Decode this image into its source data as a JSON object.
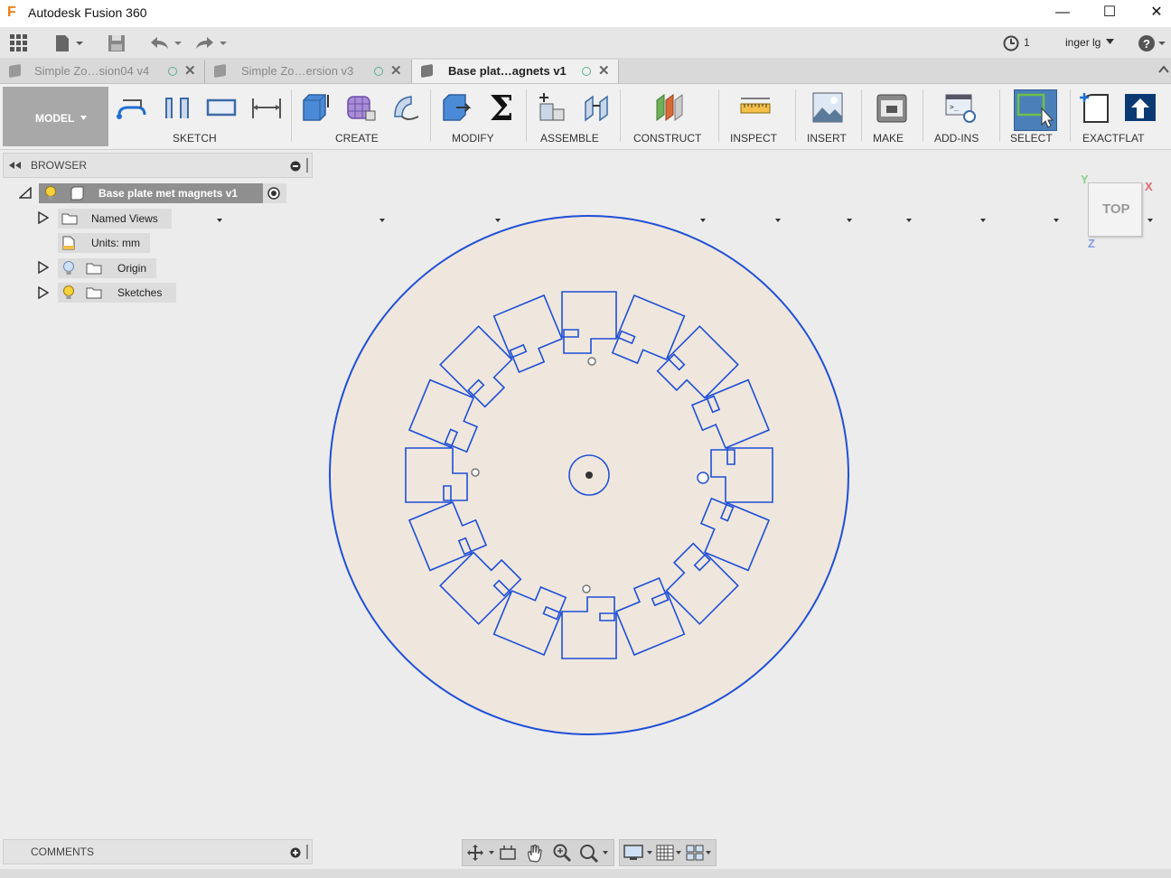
{
  "window": {
    "title": "Autodesk Fusion 360",
    "minimize": "—",
    "maximize": "☐",
    "close": "✕"
  },
  "quick_access": {
    "user": "inger lg",
    "job_count": "1"
  },
  "tabs": [
    {
      "label": "Simple Zo…sion04 v4",
      "active": false
    },
    {
      "label": "Simple Zo…ersion v3",
      "active": false
    },
    {
      "label": "Base plat…agnets v1",
      "active": true
    }
  ],
  "ribbon": {
    "workspace": "MODEL",
    "groups": [
      "SKETCH",
      "CREATE",
      "MODIFY",
      "ASSEMBLE",
      "CONSTRUCT",
      "INSPECT",
      "INSERT",
      "MAKE",
      "ADD-INS",
      "SELECT",
      "EXACTFLAT"
    ]
  },
  "browser": {
    "title": "BROWSER",
    "root": "Base plate met magnets v1",
    "items": [
      {
        "label": "Named Views"
      },
      {
        "label": "Units: mm"
      },
      {
        "label": "Origin"
      },
      {
        "label": "Sketches"
      }
    ]
  },
  "comments": {
    "title": "COMMENTS"
  },
  "viewcube": {
    "face": "TOP",
    "axis_x": "X",
    "axis_y": "Y",
    "axis_z": "Z"
  },
  "colors": {
    "sketch": "#1f4fd8",
    "plate": "#efe7dd",
    "select_active": "#4a80b9"
  }
}
